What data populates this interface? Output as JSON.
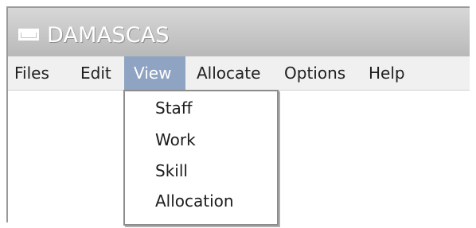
{
  "window": {
    "title": "DAMASCAS",
    "icon": "window-icon"
  },
  "menu_bar": {
    "items": [
      {
        "label": "Files"
      },
      {
        "label": "Edit"
      },
      {
        "label": "View",
        "active": true
      },
      {
        "label": "Allocate"
      },
      {
        "label": "Options"
      },
      {
        "label": "Help"
      }
    ]
  },
  "view_menu": {
    "items": [
      {
        "label": "Staff"
      },
      {
        "label": "Work"
      },
      {
        "label": "Skill"
      },
      {
        "label": "Allocation"
      }
    ]
  },
  "colors": {
    "title_bar": "#c7c7c7",
    "menu_bar": "#f0f0f0",
    "active_menu": "#8fa3c2",
    "menu_border": "#8c8c8c"
  }
}
